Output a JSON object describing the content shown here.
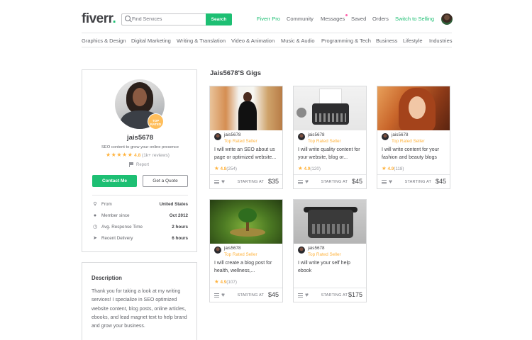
{
  "header": {
    "logo": "fiverr",
    "search_placeholder": "Find Services",
    "search_button": "Search",
    "nav": {
      "pro": "Fiverr Pro",
      "community": "Community",
      "messages": "Messages",
      "saved": "Saved",
      "orders": "Orders",
      "switch": "Switch to Selling"
    }
  },
  "categories": [
    "Graphics & Design",
    "Digital Marketing",
    "Writing & Translation",
    "Video & Animation",
    "Music & Audio",
    "Programming & Tech",
    "Business",
    "Lifestyle",
    "Industries"
  ],
  "profile": {
    "badge_line1": "TOP",
    "badge_line2": "RATED",
    "username": "jais5678",
    "tagline": "SEO content to grow your online presence",
    "stars": "★★★★★",
    "rating": "4.8",
    "reviews": "(1k+ reviews)",
    "report": "Report",
    "contact_button": "Contact Me",
    "quote_button": "Get a Quote",
    "stats": [
      {
        "icon": "location-pin-icon",
        "glyph": "⚲",
        "label": "From",
        "value": "United States"
      },
      {
        "icon": "person-icon",
        "glyph": "●",
        "label": "Member since",
        "value": "Oct 2012"
      },
      {
        "icon": "clock-icon",
        "glyph": "◷",
        "label": "Avg. Response Time",
        "value": "2 hours"
      },
      {
        "icon": "paper-plane-icon",
        "glyph": "➤",
        "label": "Recent Delivery",
        "value": "6 hours"
      }
    ]
  },
  "description": {
    "heading": "Description",
    "text": "Thank you for taking a look at my writing services! I specialize in SEO optimized website content, blog posts, online articles, ebooks, and lead magnet text to help brand and grow your business."
  },
  "gigs_title": "Jais5678'S Gigs",
  "gigs": [
    {
      "seller": "jais5678",
      "level": "Top Rated Seller",
      "title": "I will write an SEO about us page or optimized website...",
      "rating": "4.8",
      "count": "(254)",
      "starting": "STARTING AT",
      "price": "$35"
    },
    {
      "seller": "jais5678",
      "level": "Top Rated Seller",
      "title": "I will write quality content for your website, blog or...",
      "rating": "4.9",
      "count": "(120)",
      "starting": "STARTING AT",
      "price": "$45"
    },
    {
      "seller": "jais5678",
      "level": "Top Rated Seller",
      "title": "I will write content for your fashion and beauty blogs",
      "rating": "4.9",
      "count": "(118)",
      "starting": "STARTING AT",
      "price": "$45"
    },
    {
      "seller": "jais5678",
      "level": "Top Rated Seller",
      "title": "I will create a blog post for health, wellness,...",
      "rating": "4.9",
      "count": "(107)",
      "starting": "STARTING AT",
      "price": "$45"
    },
    {
      "seller": "jais5678",
      "level": "Top Rated Seller",
      "title": "I will write your self help ebook",
      "rating": "",
      "count": "",
      "starting": "STARTING AT",
      "price": "$175"
    }
  ],
  "colors": {
    "brand": "#1dbf73",
    "star": "#ffb33e",
    "text": "#404145"
  }
}
